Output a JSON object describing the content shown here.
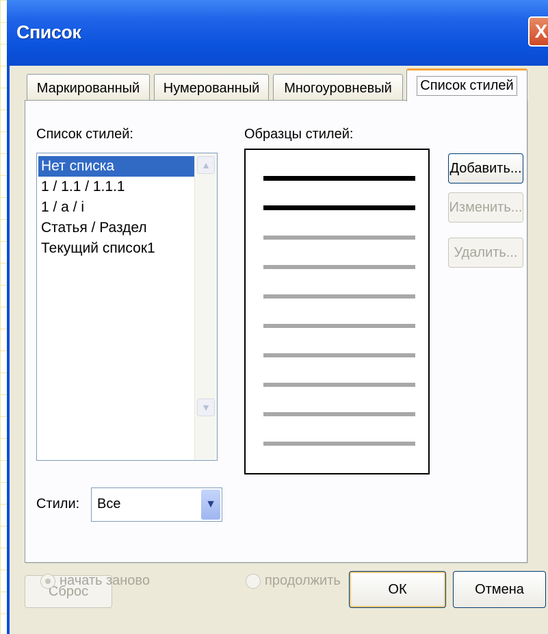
{
  "window": {
    "title": "Список",
    "close_glyph": "X"
  },
  "tabs": [
    {
      "label": "Маркированный",
      "active": false
    },
    {
      "label": "Нумерованный",
      "active": false
    },
    {
      "label": "Многоуровневый",
      "active": false
    },
    {
      "label": "Список стилей",
      "active": true
    }
  ],
  "styles_list": {
    "label": "Список стилей:",
    "items": [
      "Нет списка",
      "1 / 1.1 / 1.1.1",
      "1 / a / i",
      "Статья / Раздел",
      "Текущий список1"
    ],
    "selected_index": 0
  },
  "preview": {
    "label": "Образцы стилей:"
  },
  "filter": {
    "label": "Стили:",
    "value": "Все"
  },
  "side_buttons": {
    "add": "Добавить...",
    "edit": "Изменить...",
    "delete": "Удалить..."
  },
  "radios": {
    "restart": "начать заново",
    "continue": "продолжить",
    "restart_checked": true
  },
  "footer": {
    "reset": "Сброс",
    "ok": "ОК",
    "cancel": "Отмена"
  },
  "icons": {
    "close": "close-icon",
    "scroll_up": "chevron-up-icon",
    "scroll_down": "chevron-down-icon",
    "dropdown": "chevron-down-icon"
  },
  "colors": {
    "titlebar": "#0a4fd6",
    "selection": "#316ac5",
    "active_tab_accent": "#f5a53a",
    "client_bg": "#ece9d8"
  }
}
